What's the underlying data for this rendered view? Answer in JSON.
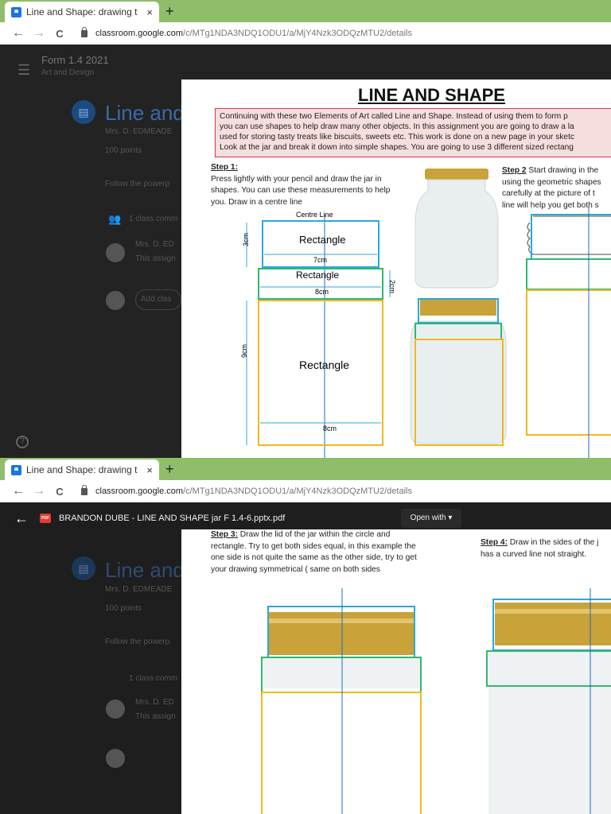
{
  "browser": {
    "tab_title": "Line and Shape: drawing t",
    "tab_close": "×",
    "new_tab": "+",
    "url_host": "classroom.google.com",
    "url_path": "/c/MTg1NDA3NDQ1ODU1/a/MjY4Nzk3ODQzMTU2/details",
    "back": "←",
    "forward": "→",
    "reload": "C"
  },
  "classroom": {
    "class_name": "Form 1.4 2021",
    "class_subject": "Art and Design",
    "assignment_title": "Line and",
    "teacher": "Mrs. D. EDMEADE",
    "points": "100 points",
    "instructions": "Follow the powerp",
    "class_comments": "1 class comm",
    "comment_author": "Mrs. D. ED",
    "comment_text": "This assign",
    "add_comment": "Add clas",
    "help_icon": "?"
  },
  "doc1": {
    "title": "LINE AND SHAPE",
    "intro": [
      "Continuing with these two Elements of Art called Line and Shape. Instead of using them to form p",
      "you can use shapes to help draw many other objects. In this assignment you are going to draw a la",
      "used for storing tasty treats like biscuits, sweets etc. This work is done on a new page in your sketc",
      "Look at the jar and break it down into simple shapes. You are going to use 3 different sized rectang"
    ],
    "step1_label": "Step 1:",
    "step1_lines": [
      "Press lightly with your pencil and draw the jar in",
      "shapes. You can use these measurements to help",
      "you. Draw in a centre line"
    ],
    "centre_line": "Centre Line",
    "rect_label": "Rectangle",
    "dim_7cm": "7cm",
    "dim_8cm": "8cm",
    "dim_3cm": "3cm",
    "dim_2cm": "2cm",
    "dim_9cm": "9cm",
    "step2_label": "Step 2",
    "step2_lines": [
      " Start drawing in the",
      "using the geometric shapes",
      "carefully at the picture of t",
      "line will help you get both s"
    ]
  },
  "viewer": {
    "file_name": "BRANDON DUBE - LINE AND SHAPE jar F 1.4-6.pptx.pdf",
    "open_with": "Open with ▾",
    "back_icon": "←",
    "pdf_badge": "PDF"
  },
  "doc2": {
    "step3_label": "Step 3:",
    "step3_lines": [
      " Draw the lid of the jar within the circle and",
      "rectangle. Try to get both sides equal, in this example the",
      "one side is not quite the same as the other side, try to get",
      "your drawing symmetrical ( same on both sides"
    ],
    "step4_label": "Step 4:",
    "step4_lines": [
      " Draw in the sides of the j",
      "has a curved line not straight."
    ]
  },
  "colors": {
    "tab_bar": "#8fbd6a",
    "blue_box": "#29a8e0",
    "green_box": "#2eb872",
    "yellow_box": "#f2b71f",
    "intro_bg": "#f6dede"
  }
}
